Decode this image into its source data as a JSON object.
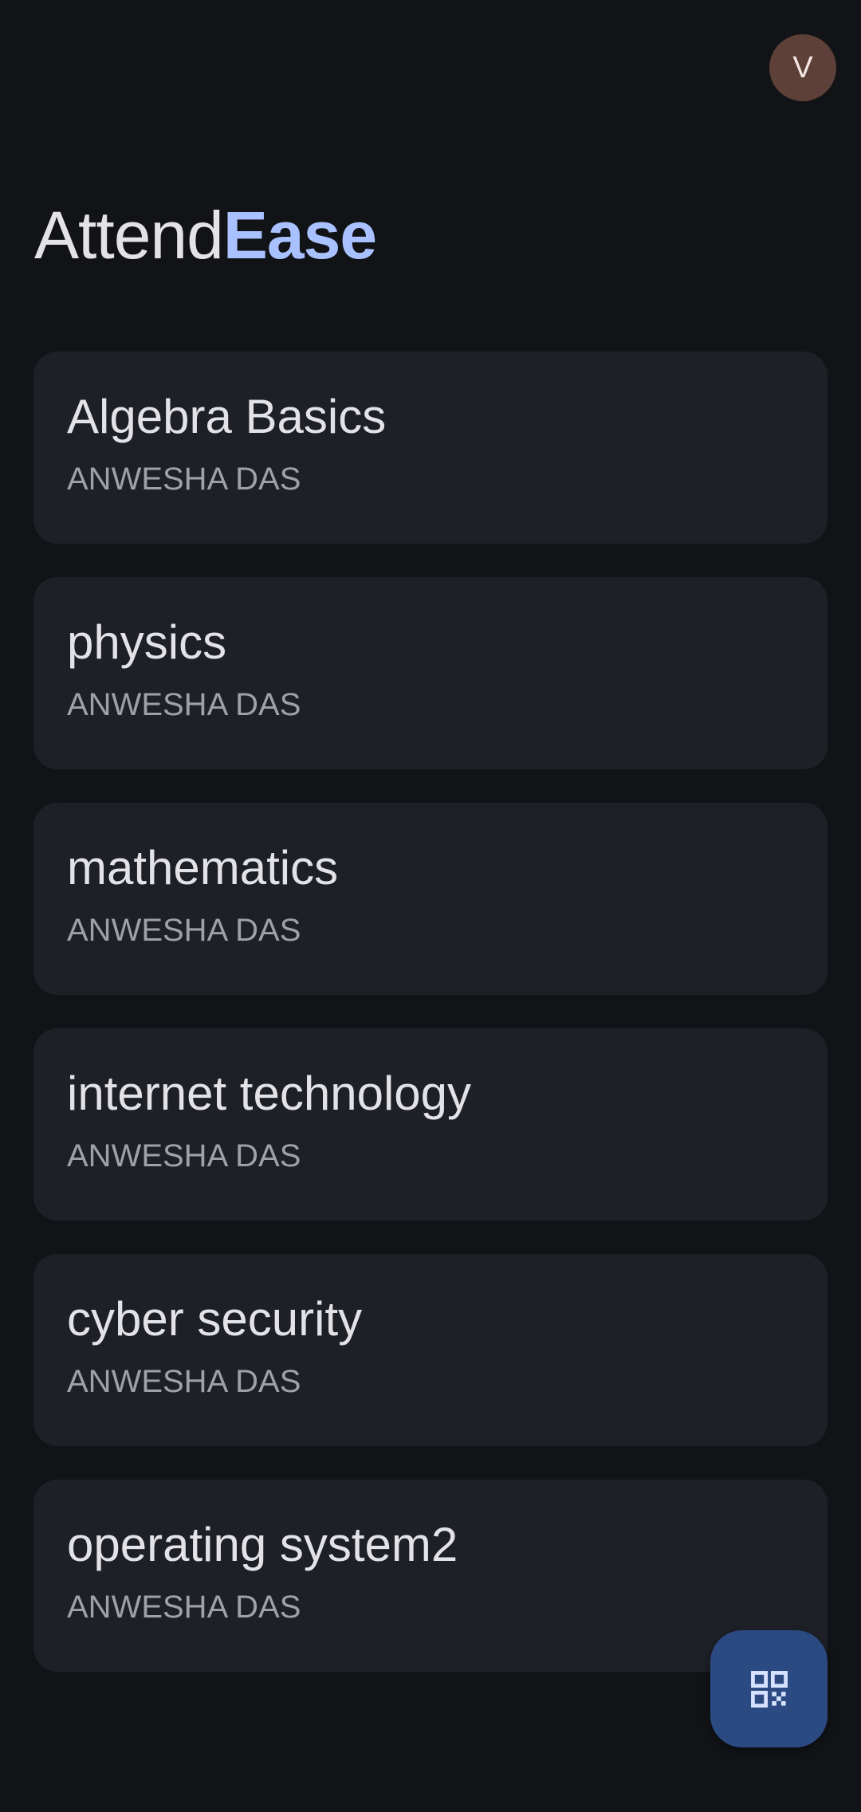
{
  "header": {
    "avatar_initial": "V",
    "title_part1": "Attend",
    "title_part2": "Ease"
  },
  "classes": [
    {
      "name": "Algebra Basics",
      "teacher": "ANWESHA DAS"
    },
    {
      "name": "physics",
      "teacher": "ANWESHA DAS"
    },
    {
      "name": "mathematics",
      "teacher": "ANWESHA DAS"
    },
    {
      "name": "internet technology",
      "teacher": "ANWESHA DAS"
    },
    {
      "name": "cyber security",
      "teacher": "ANWESHA DAS"
    },
    {
      "name": "operating system2",
      "teacher": "ANWESHA DAS"
    }
  ],
  "fab": {
    "icon": "qr-code-icon"
  },
  "colors": {
    "background": "#111317",
    "card": "#1e2027",
    "accent": "#a9c2ff",
    "avatar": "#5d4037",
    "fab": "#2c4a82"
  }
}
